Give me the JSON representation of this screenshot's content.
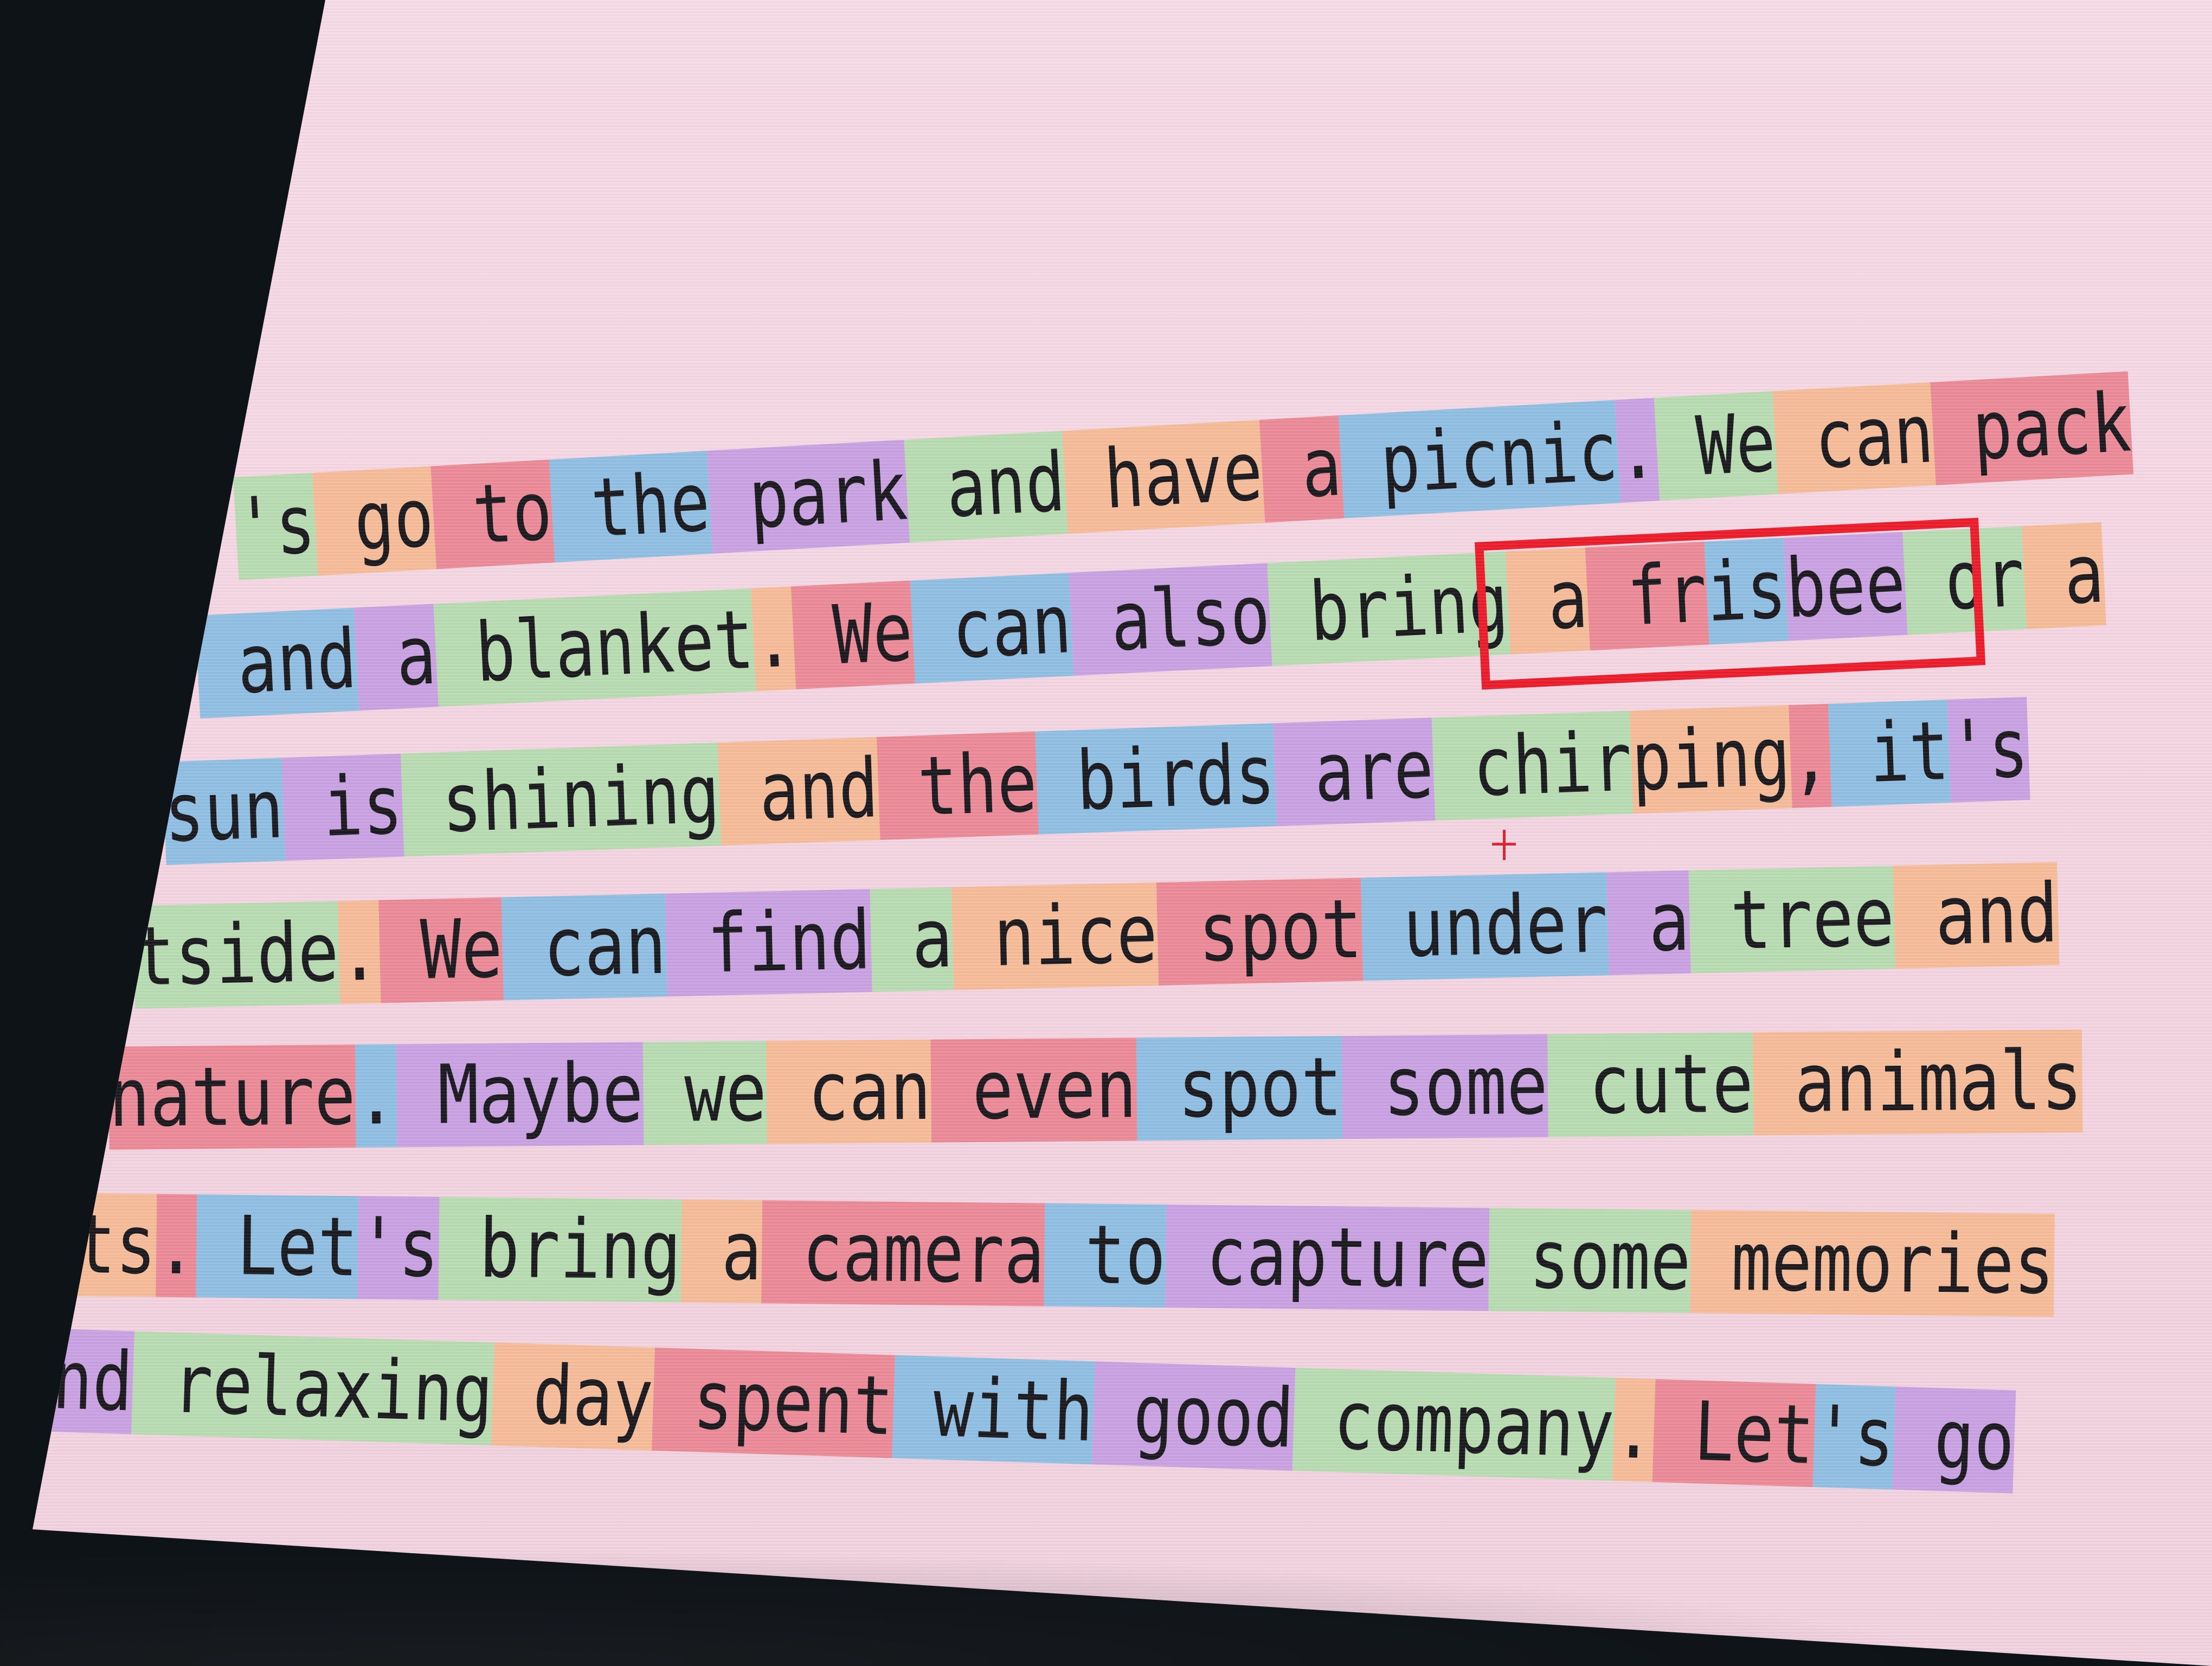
{
  "colors": {
    "pink": "#ec8a98",
    "blue": "#8fbfe3",
    "purple": "#c9a2e2",
    "green": "#b8dcb2",
    "orange": "#f6bc98",
    "selection_box": "#ec1c2b",
    "background": "#f4d6e2",
    "text": "#1a1a1e"
  },
  "lines": [
    {
      "tokens": [
        {
          "text": "'s",
          "color": "green"
        },
        {
          "text": " go",
          "color": "orange"
        },
        {
          "text": " to",
          "color": "pink"
        },
        {
          "text": " the",
          "color": "blue"
        },
        {
          "text": " park",
          "color": "purple"
        },
        {
          "text": " and",
          "color": "green"
        },
        {
          "text": " have",
          "color": "orange"
        },
        {
          "text": " a",
          "color": "pink"
        },
        {
          "text": " picnic",
          "color": "blue"
        },
        {
          "text": ".",
          "color": "purple"
        },
        {
          "text": " We",
          "color": "green"
        },
        {
          "text": " can",
          "color": "orange"
        },
        {
          "text": " pack",
          "color": "pink"
        }
      ]
    },
    {
      "tokens": [
        {
          "text": " and",
          "color": "blue"
        },
        {
          "text": " a",
          "color": "purple"
        },
        {
          "text": " blanket",
          "color": "green"
        },
        {
          "text": ".",
          "color": "orange"
        },
        {
          "text": " We",
          "color": "pink"
        },
        {
          "text": " can",
          "color": "blue"
        },
        {
          "text": " also",
          "color": "purple"
        },
        {
          "text": " bring",
          "color": "green"
        },
        {
          "text": " a",
          "color": "orange"
        },
        {
          "text": " fr",
          "color": "pink"
        },
        {
          "text": "is",
          "color": "blue"
        },
        {
          "text": "bee",
          "color": "purple"
        },
        {
          "text": " or",
          "color": "green"
        },
        {
          "text": " a",
          "color": "orange"
        }
      ]
    },
    {
      "tokens": [
        {
          "text": "sun",
          "color": "blue"
        },
        {
          "text": " is",
          "color": "purple"
        },
        {
          "text": " shining",
          "color": "green"
        },
        {
          "text": " and",
          "color": "orange"
        },
        {
          "text": " the",
          "color": "pink"
        },
        {
          "text": " birds",
          "color": "blue"
        },
        {
          "text": " are",
          "color": "purple"
        },
        {
          "text": " chir",
          "color": "green"
        },
        {
          "text": "ping",
          "color": "orange"
        },
        {
          "text": ",",
          "color": "pink"
        },
        {
          "text": " it",
          "color": "blue"
        },
        {
          "text": "'s",
          "color": "purple"
        }
      ]
    },
    {
      "tokens": [
        {
          "text": "tside",
          "color": "green"
        },
        {
          "text": ".",
          "color": "orange"
        },
        {
          "text": " We",
          "color": "pink"
        },
        {
          "text": " can",
          "color": "blue"
        },
        {
          "text": " find",
          "color": "purple"
        },
        {
          "text": " a",
          "color": "green"
        },
        {
          "text": " nice",
          "color": "orange"
        },
        {
          "text": " spot",
          "color": "pink"
        },
        {
          "text": " under",
          "color": "blue"
        },
        {
          "text": " a",
          "color": "purple"
        },
        {
          "text": " tree",
          "color": "green"
        },
        {
          "text": " and",
          "color": "orange"
        }
      ]
    },
    {
      "tokens": [
        {
          "text": "nature",
          "color": "pink"
        },
        {
          "text": ".",
          "color": "blue"
        },
        {
          "text": " Maybe",
          "color": "purple"
        },
        {
          "text": " we",
          "color": "green"
        },
        {
          "text": " can",
          "color": "orange"
        },
        {
          "text": " even",
          "color": "pink"
        },
        {
          "text": " spot",
          "color": "blue"
        },
        {
          "text": " some",
          "color": "purple"
        },
        {
          "text": " cute",
          "color": "green"
        },
        {
          "text": " animals",
          "color": "orange"
        }
      ]
    },
    {
      "tokens": [
        {
          "text": "ts",
          "color": "orange"
        },
        {
          "text": ".",
          "color": "pink"
        },
        {
          "text": " Let",
          "color": "blue"
        },
        {
          "text": "'s",
          "color": "purple"
        },
        {
          "text": " bring",
          "color": "green"
        },
        {
          "text": " a",
          "color": "orange"
        },
        {
          "text": " camera",
          "color": "pink"
        },
        {
          "text": " to",
          "color": "blue"
        },
        {
          "text": " capture",
          "color": "purple"
        },
        {
          "text": " some",
          "color": "green"
        },
        {
          "text": " memories",
          "color": "orange"
        }
      ]
    },
    {
      "tokens": [
        {
          "text": "nd",
          "color": "purple"
        },
        {
          "text": " relaxing",
          "color": "green"
        },
        {
          "text": " day",
          "color": "orange"
        },
        {
          "text": " spent",
          "color": "pink"
        },
        {
          "text": " with",
          "color": "blue"
        },
        {
          "text": " good",
          "color": "purple"
        },
        {
          "text": " company",
          "color": "green"
        },
        {
          "text": ".",
          "color": "orange"
        },
        {
          "text": " Let",
          "color": "pink"
        },
        {
          "text": "'s",
          "color": "blue"
        },
        {
          "text": " go",
          "color": "purple"
        }
      ]
    }
  ]
}
